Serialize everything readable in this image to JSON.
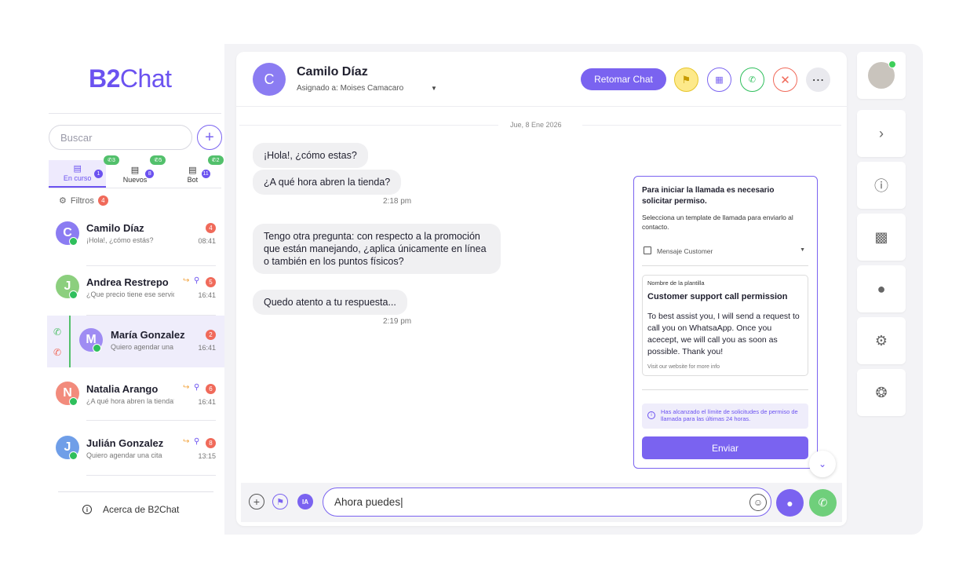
{
  "brand": {
    "logo_bold": "B2",
    "logo_rest": "Chat"
  },
  "sidebar": {
    "search_placeholder": "Buscar",
    "tabs": [
      {
        "label": "En curso",
        "count": "1",
        "calls": "3"
      },
      {
        "label": "Nuevos",
        "count": "8",
        "calls": "5"
      },
      {
        "label": "Bot",
        "count": "11",
        "calls": "2"
      }
    ],
    "filters": {
      "label": "Filtros",
      "count": "4"
    },
    "conversations": [
      {
        "initial": "C",
        "name": "Camilo Díaz",
        "preview": "¡Hola!, ¿cómo estás?",
        "time": "08:41",
        "badge": "4",
        "color": "#8b7cf2"
      },
      {
        "initial": "J",
        "name": "Andrea Restrepo",
        "preview": "¿Que precio tiene ese servicio?",
        "time": "16:41",
        "badge": "5",
        "color": "#8ccf7e"
      },
      {
        "initial": "M",
        "name": "María Gonzalez",
        "preview": "Quiero agendar una cita",
        "time": "16:41",
        "badge": "2",
        "color": "#9f8cf3"
      },
      {
        "initial": "N",
        "name": "Natalia Arango",
        "preview": "¿A qué hora abren la tienda?",
        "time": "16:41",
        "badge": "6",
        "color": "#f28b7c"
      },
      {
        "initial": "J",
        "name": "Julián Gonzalez",
        "preview": "Quiero agendar una cita",
        "time": "13:15",
        "badge": "8",
        "color": "#6f9ee8"
      }
    ],
    "about": "Acerca de B2Chat"
  },
  "chat": {
    "avatar_initial": "C",
    "contact_name": "Camilo Díaz",
    "assigned": "Asignado a: Moises Camacaro",
    "retomar_label": "Retomar Chat",
    "date": "Jue, 8 Ene 2026",
    "messages": [
      {
        "text": "¡Hola!, ¿cómo estas?"
      },
      {
        "text": "¿A qué hora abren la tienda?",
        "time": "2:18 pm"
      },
      {
        "text": "Tengo otra pregunta: con respecto a la promoción que están manejando, ¿aplica únicamente en línea o también en los puntos físicos?"
      },
      {
        "text": "Quedo atento a tu respuesta...",
        "time": "2:19 pm"
      }
    ],
    "composer_value": "Ahora puedes|",
    "ia_label": "IA"
  },
  "permission": {
    "title": "Para iniciar la llamada es necesario solicitar permiso.",
    "subtitle": "Selecciona un template de llamada para enviarlo al contacto.",
    "select_value": "Mensaje Customer",
    "template_label": "Nombre de la plantilla",
    "template_name": "Customer support call permission",
    "template_body": "To best assist you, I will send a request to call you on WhatsaApp. Once you acecept, we will call you as soon as possible. Thank you!",
    "template_footer": "Visit our website for more info",
    "limit_text": "Has alcanzado el límite de solicitudes de permiso de llamada para las últimas 24 horas.",
    "send_label": "Enviar"
  },
  "colors": {
    "accent": "#7a63f0",
    "green": "#52c06b",
    "badge_red": "#f06a5a"
  }
}
